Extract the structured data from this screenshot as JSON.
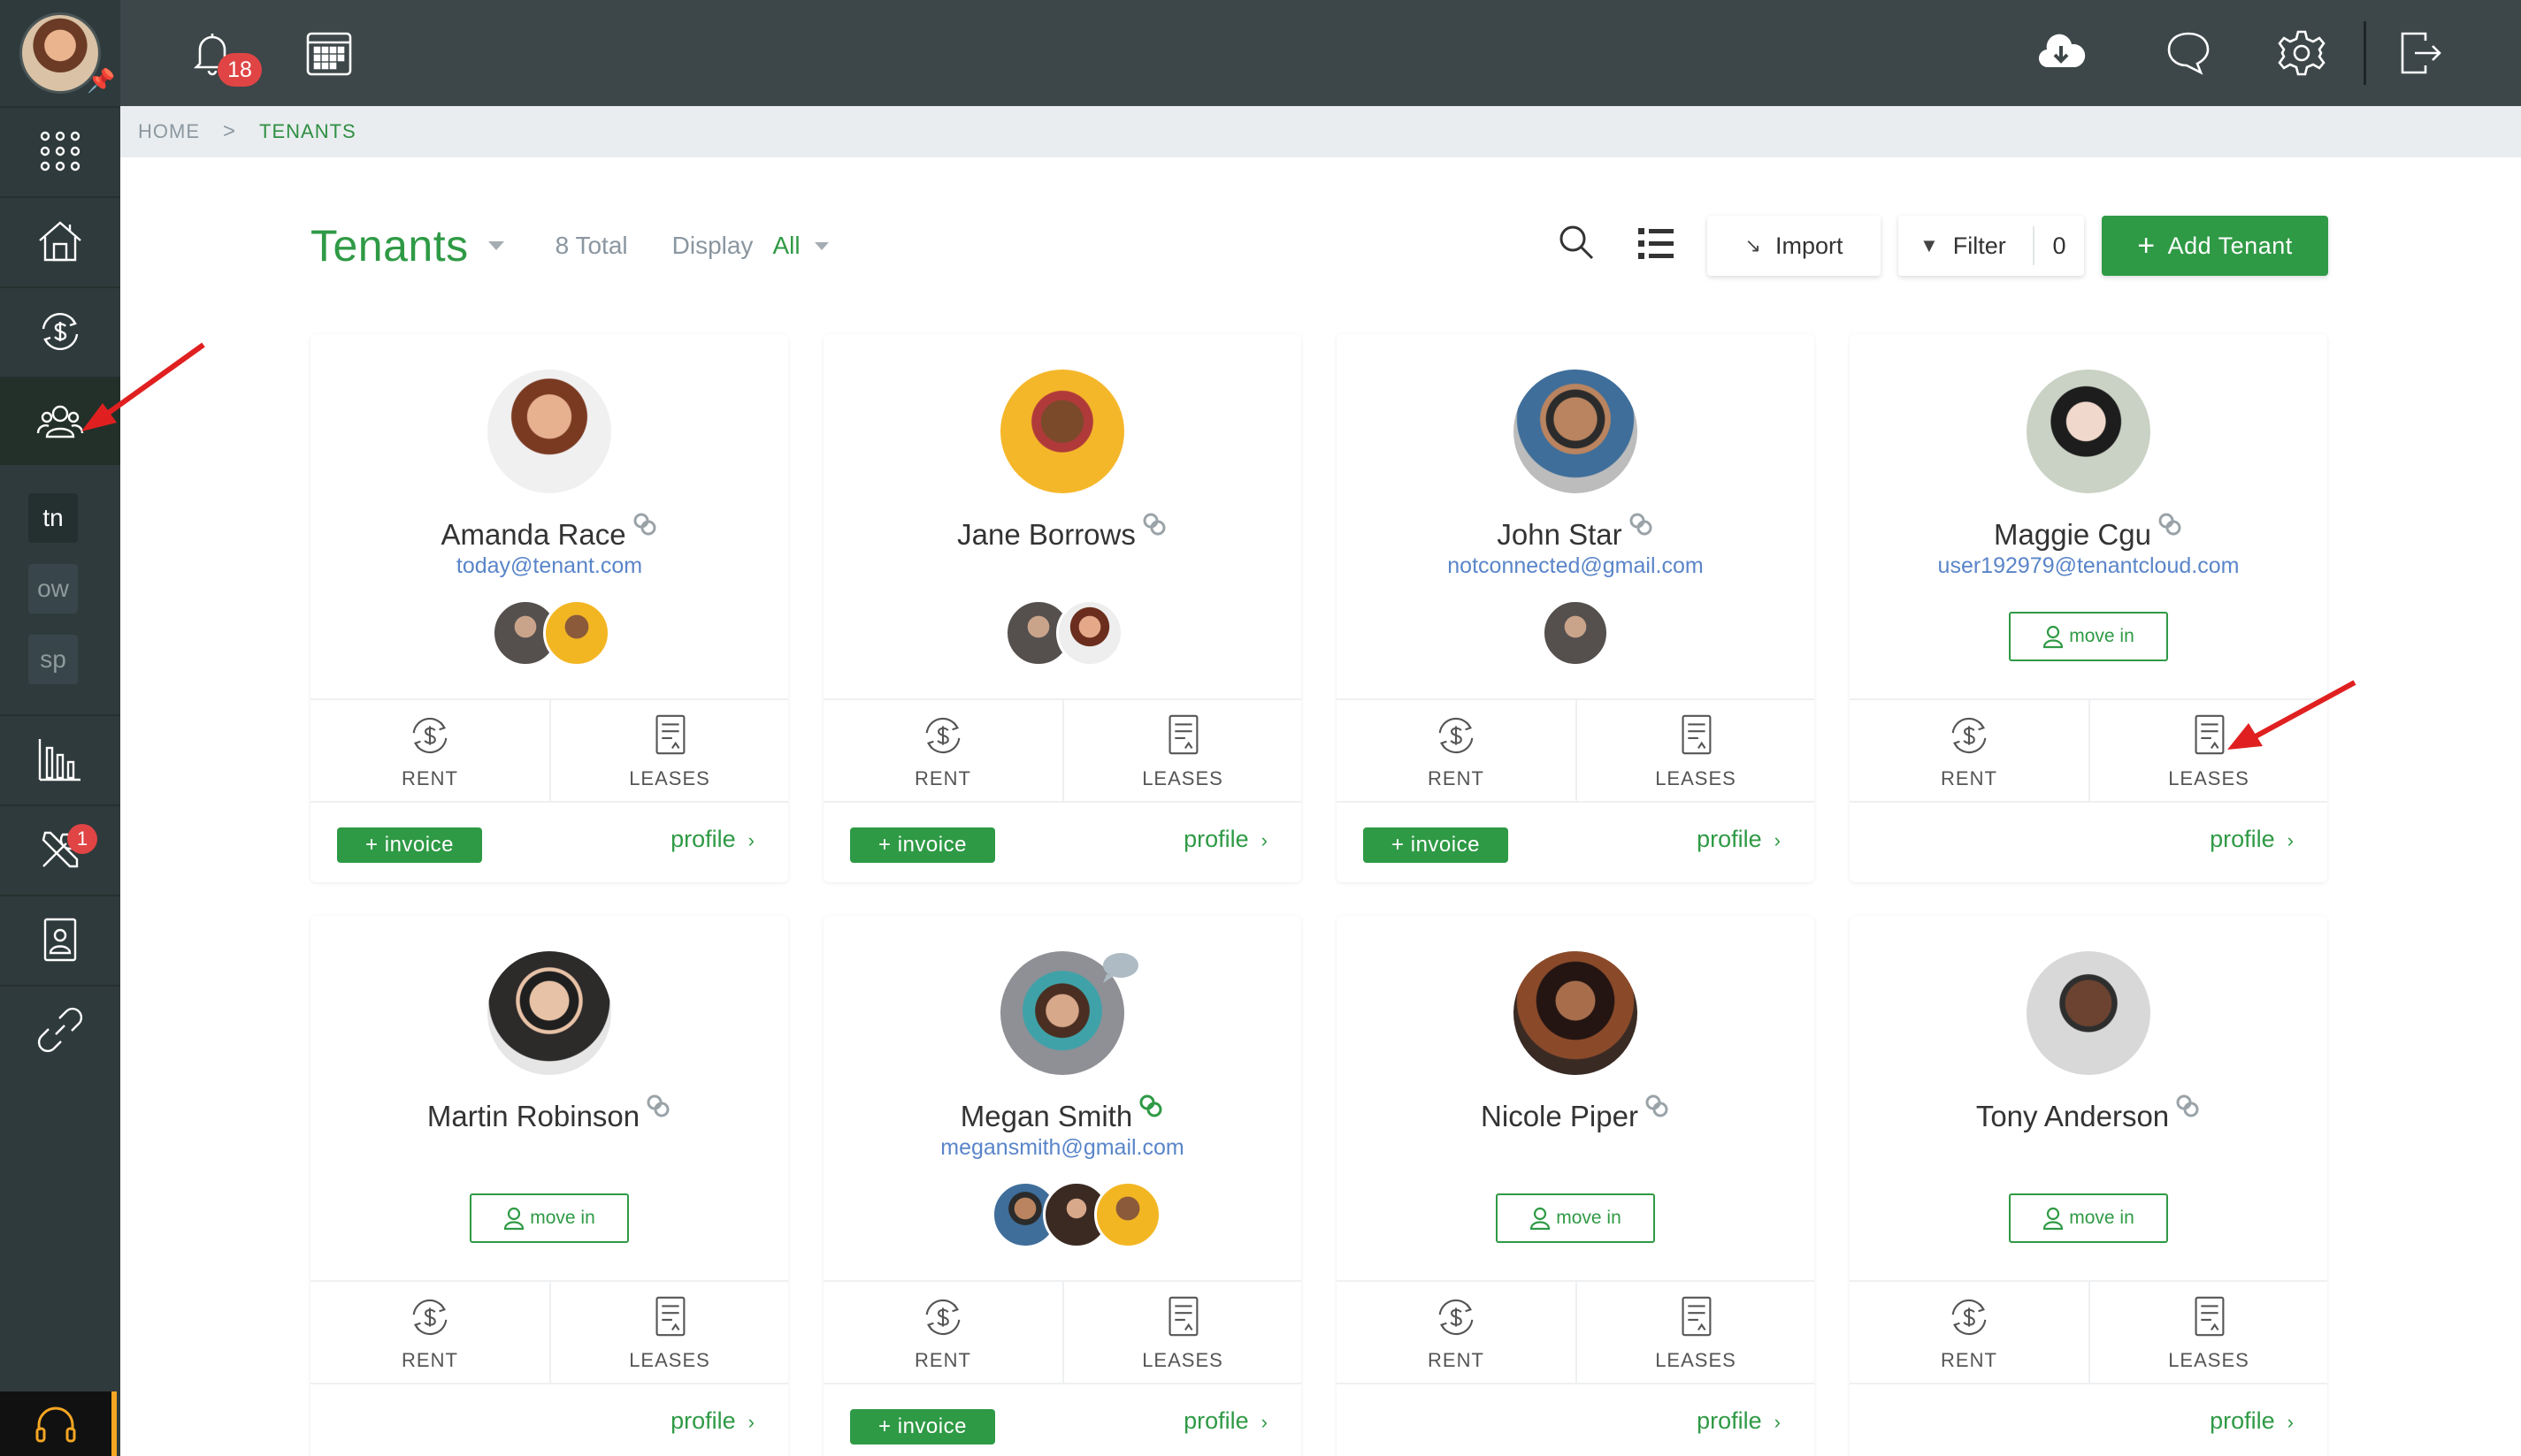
{
  "sidebar": {
    "badge_tools": "1",
    "workspaces": [
      "tn",
      "ow",
      "sp"
    ]
  },
  "topbar": {
    "notifications_count": "18"
  },
  "breadcrumb": {
    "home": "HOME",
    "separator": ">",
    "current": "TENANTS"
  },
  "header": {
    "title": "Tenants",
    "total": "8 Total",
    "display_label": "Display",
    "display_value": "All",
    "import_label": "Import",
    "filter_label": "Filter",
    "filter_count": "0",
    "add_label": "Add Tenant"
  },
  "labels": {
    "rent": "RENT",
    "leases": "LEASES",
    "invoice": "+ invoice",
    "profile": "profile",
    "move_in": "move in"
  },
  "tenants": [
    {
      "name": "Amanda Race",
      "email": "today@tenant.com"
    },
    {
      "name": "Jane Borrows",
      "email": ""
    },
    {
      "name": "John Star",
      "email": "notconnected@gmail.com"
    },
    {
      "name": "Maggie Cgu",
      "email": "user192979@tenantcloud.com"
    },
    {
      "name": "Martin Robinson",
      "email": ""
    },
    {
      "name": "Megan Smith",
      "email": "megansmith@gmail.com"
    },
    {
      "name": "Nicole Piper",
      "email": ""
    },
    {
      "name": "Tony Anderson",
      "email": ""
    }
  ],
  "colors": {
    "accent": "#2f9a45",
    "sidebar": "#2f3a3c",
    "topbar": "#3d474a",
    "badge": "#e04444",
    "link": "#5a85c9"
  }
}
